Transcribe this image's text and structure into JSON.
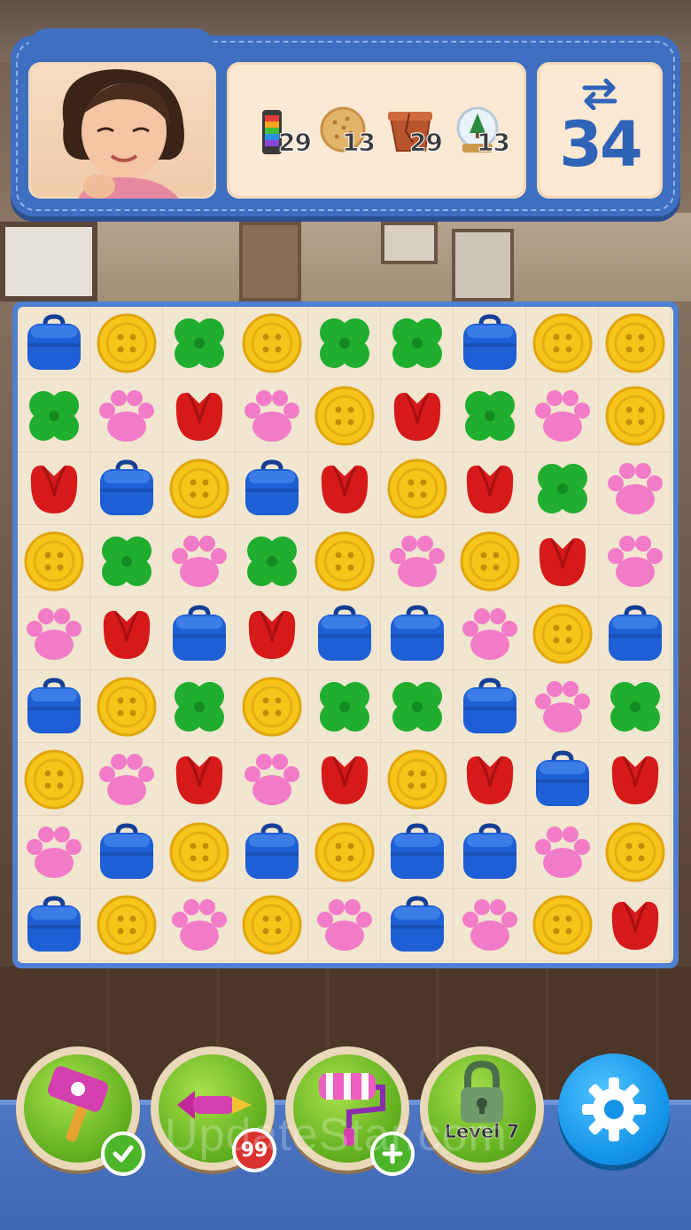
{
  "goals": [
    {
      "icon": "rainbow-thread-spool-icon",
      "count": "29"
    },
    {
      "icon": "cookie-icon",
      "count": "13"
    },
    {
      "icon": "broken-flowerpot-icon",
      "count": "29"
    },
    {
      "icon": "snow-globe-icon",
      "count": "13"
    }
  ],
  "moves": {
    "icon": "swap-arrows-icon",
    "value": "34"
  },
  "board": {
    "rows": 9,
    "cols": 9,
    "tiles": [
      [
        "bag",
        "button",
        "clover",
        "button",
        "clover",
        "clover",
        "bag",
        "button",
        "button"
      ],
      [
        "clover",
        "paw",
        "tulip",
        "paw",
        "button",
        "tulip",
        "clover",
        "paw",
        "button"
      ],
      [
        "tulip",
        "bag",
        "button",
        "bag",
        "tulip",
        "button",
        "tulip",
        "clover",
        "paw"
      ],
      [
        "button",
        "clover",
        "paw",
        "clover",
        "button",
        "paw",
        "button",
        "tulip",
        "paw"
      ],
      [
        "paw",
        "tulip",
        "bag",
        "tulip",
        "bag",
        "bag",
        "paw",
        "button",
        "bag"
      ],
      [
        "bag",
        "button",
        "clover",
        "button",
        "clover",
        "clover",
        "bag",
        "paw",
        "clover"
      ],
      [
        "button",
        "paw",
        "tulip",
        "paw",
        "tulip",
        "button",
        "tulip",
        "bag",
        "tulip"
      ],
      [
        "paw",
        "bag",
        "button",
        "bag",
        "button",
        "bag",
        "bag",
        "paw",
        "button"
      ],
      [
        "bag",
        "button",
        "paw",
        "button",
        "paw",
        "bag",
        "paw",
        "button",
        "tulip"
      ]
    ]
  },
  "tile_colors": {
    "bag": "#1f5fd6",
    "button": "#f7c51a",
    "clover": "#1fae2e",
    "tulip": "#d61a1a",
    "paw": "#f27cc8"
  },
  "boosters": [
    {
      "name": "hammer-booster",
      "icon": "paw-hammer-icon",
      "badge": "check"
    },
    {
      "name": "rocket-booster",
      "icon": "pink-rocket-icon",
      "badge": "99"
    },
    {
      "name": "roller-booster",
      "icon": "paint-roller-icon",
      "badge": "plus"
    },
    {
      "name": "locked-booster",
      "icon": "padlock-icon",
      "label": "Level 7"
    }
  ],
  "settings": {
    "icon": "gear-icon"
  },
  "watermark": "UpdateStar.com"
}
